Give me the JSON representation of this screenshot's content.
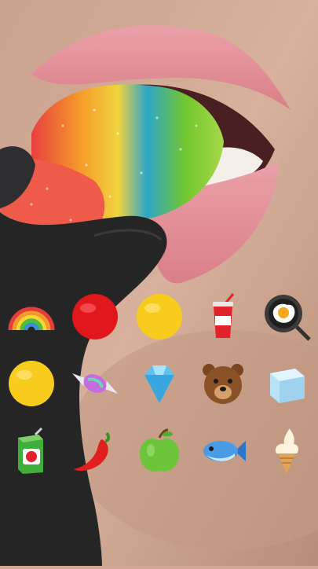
{
  "screen": {
    "type": "food emoji pick overlay on video frame"
  },
  "emoji_grid": {
    "rows": [
      [
        "rainbow-emoji",
        "red-circle-emoji",
        "yellow-circle-emoji",
        "soda-cup-emoji",
        "fried-egg-pan-emoji"
      ],
      [
        "yellow-circle-emoji",
        "candy-emoji",
        "gem-emoji",
        "bear-face-emoji",
        "ice-cube-emoji"
      ],
      [
        "juice-box-emoji",
        "hot-pepper-emoji",
        "green-apple-emoji",
        "fish-emoji",
        "soft-ice-cream-emoji"
      ]
    ]
  },
  "colors": {
    "skin": "#d3a993",
    "lip": "#e9969f",
    "glove": "#252526",
    "candy_red": "#ec4645",
    "candy_green": "#72c62e",
    "candy_blue": "#2ea6c8"
  }
}
